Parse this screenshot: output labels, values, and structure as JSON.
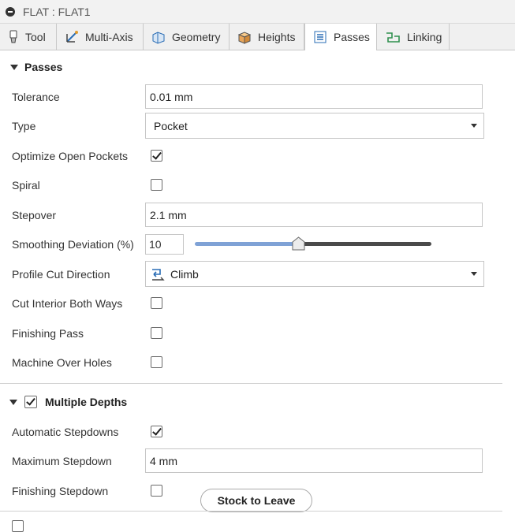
{
  "window": {
    "title": "FLAT : FLAT1"
  },
  "tabs": [
    {
      "label": "Tool",
      "icon": "tool-icon"
    },
    {
      "label": "Multi-Axis",
      "icon": "multi-axis-icon"
    },
    {
      "label": "Geometry",
      "icon": "geometry-icon"
    },
    {
      "label": "Heights",
      "icon": "heights-icon"
    },
    {
      "label": "Passes",
      "icon": "passes-icon",
      "active": true
    },
    {
      "label": "Linking",
      "icon": "linking-icon"
    }
  ],
  "passes": {
    "header": "Passes",
    "tolerance": {
      "label": "Tolerance",
      "value": "0.01 mm"
    },
    "type": {
      "label": "Type",
      "value": "Pocket"
    },
    "optimize_open_pockets": {
      "label": "Optimize Open Pockets",
      "checked": true
    },
    "spiral": {
      "label": "Spiral",
      "checked": false
    },
    "stepover": {
      "label": "Stepover",
      "value": "2.1 mm"
    },
    "smoothing_deviation": {
      "label": "Smoothing Deviation (%)",
      "value": "10",
      "slider_fraction": 0.44
    },
    "profile_cut_direction": {
      "label": "Profile Cut Direction",
      "value": "Climb"
    },
    "cut_interior_both_ways": {
      "label": "Cut Interior Both Ways",
      "checked": false
    },
    "finishing_pass": {
      "label": "Finishing Pass",
      "checked": false
    },
    "machine_over_holes": {
      "label": "Machine Over Holes",
      "checked": false
    }
  },
  "multiple_depths": {
    "header": "Multiple Depths",
    "enabled": true,
    "automatic_stepdowns": {
      "label": "Automatic Stepdowns",
      "checked": true
    },
    "maximum_stepdown": {
      "label": "Maximum Stepdown",
      "value": "4 mm"
    },
    "finishing_stepdown": {
      "label": "Finishing Stepdown",
      "checked": false
    }
  },
  "tooltip": {
    "label": "Stock to Leave"
  },
  "colors": {
    "slider_fill": "#7fa2d6",
    "slider_track": "#4a4a4a"
  }
}
